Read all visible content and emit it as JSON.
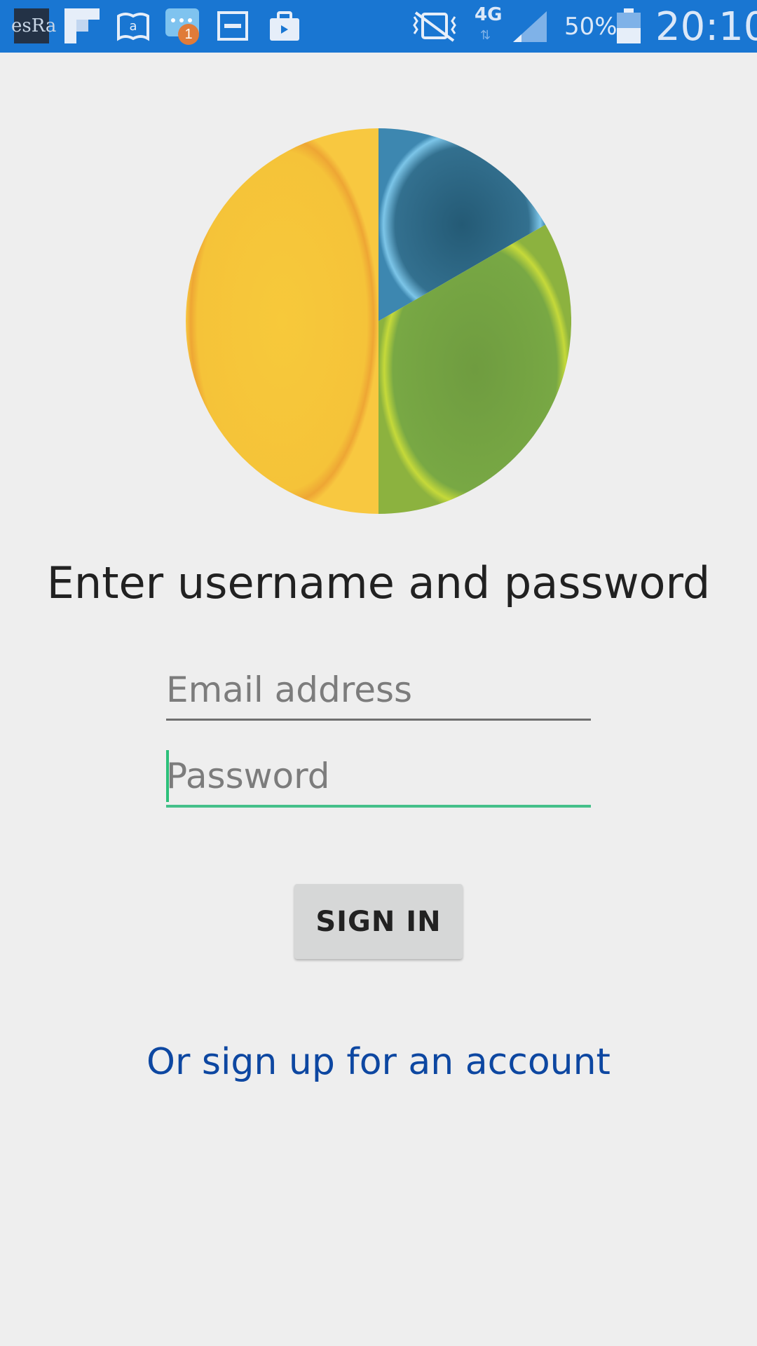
{
  "status_bar": {
    "time": "20:10",
    "battery": "50%",
    "network": "4G",
    "notification_count": "1",
    "app_badge_text": "esRa",
    "icons": [
      "app-logo-icon",
      "flipboard-icon",
      "amazon-kindle-icon",
      "messages-icon",
      "media-icon",
      "briefcase-icon",
      "vibrate-icon",
      "network-4g-icon",
      "signal-icon",
      "battery-icon"
    ]
  },
  "logo": {
    "colors": {
      "yellow": "#f6c53a",
      "green": "#74a443",
      "blue": "#2e6482"
    }
  },
  "login": {
    "title": "Enter username and password",
    "email_placeholder": "Email address",
    "password_placeholder": "Password",
    "sign_in_label": "SIGN IN",
    "sign_up_link": "Or sign up for an account"
  },
  "colors": {
    "status_bar": "#1976d2",
    "background": "#eeeeee",
    "accent": "#45c08a",
    "link": "#0d47a1"
  }
}
